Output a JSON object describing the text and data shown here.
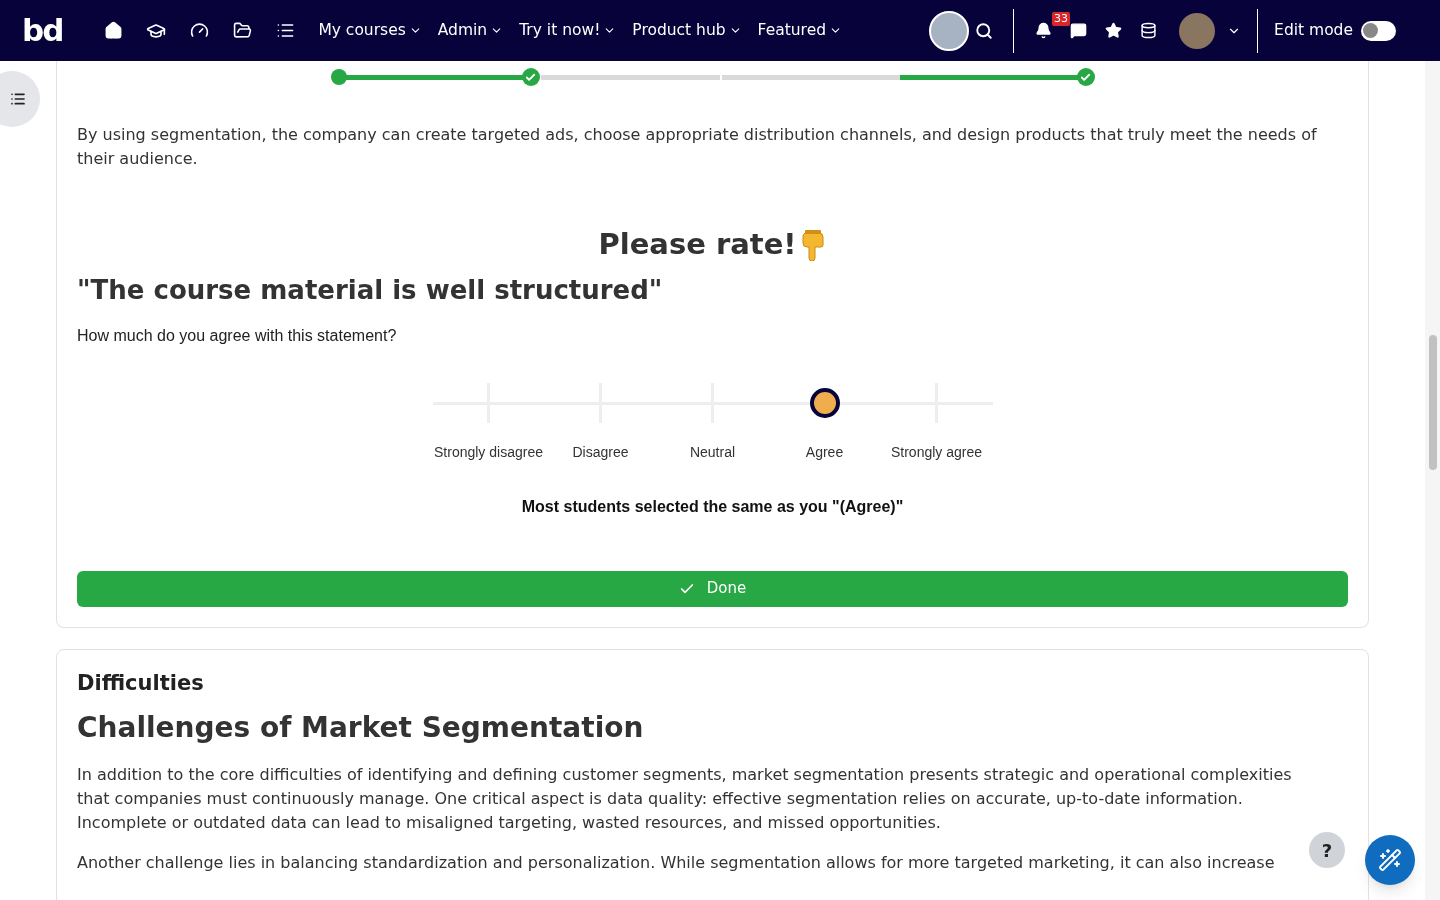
{
  "navbar": {
    "logo": "bd",
    "menus": [
      {
        "label": "My courses"
      },
      {
        "label": "Admin"
      },
      {
        "label": "Try it now!"
      },
      {
        "label": "Product hub"
      },
      {
        "label": "Featured"
      }
    ],
    "notification_count": "33",
    "edit_mode": {
      "label": "Edit mode",
      "on": false
    }
  },
  "progress": {
    "segments": [
      {
        "complete": true
      },
      {
        "complete": false
      },
      {
        "complete": false
      },
      {
        "complete": true
      }
    ]
  },
  "intro_text": "By using segmentation, the company can create targeted ads, choose appropriate distribution channels, and design products that truly meet the needs of their audience.",
  "rating": {
    "title": "Please rate!",
    "statement": "\"The course material is well structured\"",
    "question": "How much do you agree with this statement?",
    "options": [
      {
        "label": "Strongly disagree",
        "selected": false
      },
      {
        "label": "Disagree",
        "selected": false
      },
      {
        "label": "Neutral",
        "selected": false
      },
      {
        "label": "Agree",
        "selected": true
      },
      {
        "label": "Strongly agree",
        "selected": false
      }
    ],
    "result": "Most students selected the same as you \"(Agree)\"",
    "done_button": "Done"
  },
  "section": {
    "label": "Difficulties",
    "title": "Challenges of Market Segmentation",
    "paragraphs": [
      "In addition to the core difficulties of identifying and defining customer segments, market segmentation presents strategic and operational complexities that companies must continuously manage. One critical aspect is data quality: effective segmentation relies on accurate, up-to-date information. Incomplete or outdated data can lead to misaligned targeting, wasted resources, and missed opportunities.",
      "Another challenge lies in balancing standardization and personalization. While segmentation allows for more targeted marketing, it can also increase"
    ]
  },
  "help_button": "?"
}
